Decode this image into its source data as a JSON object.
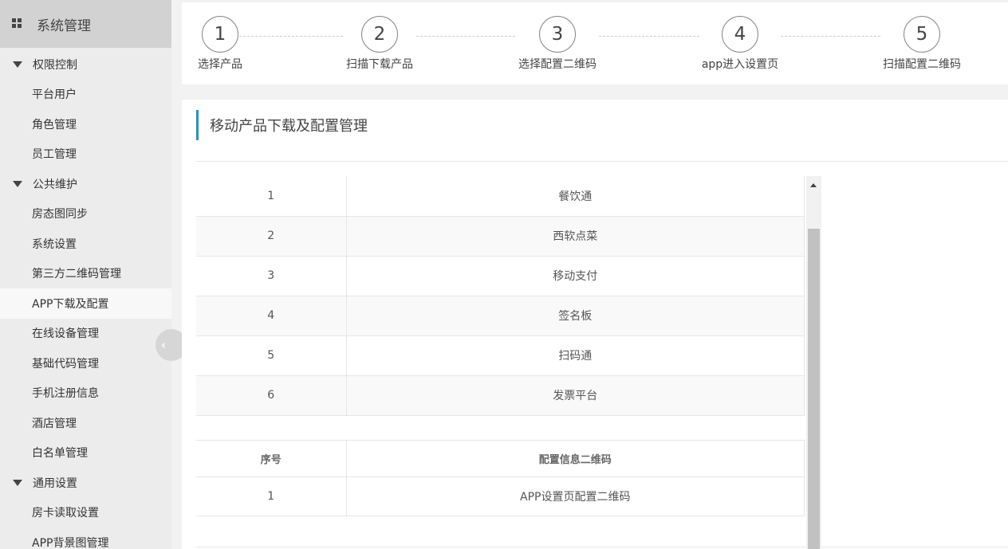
{
  "sidebar": {
    "title": "系统管理",
    "groups": [
      {
        "label": "权限控制",
        "items": [
          "平台用户",
          "角色管理",
          "员工管理"
        ]
      },
      {
        "label": "公共维护",
        "items": [
          "房态图同步",
          "系统设置",
          "第三方二维码管理",
          "APP下载及配置",
          "在线设备管理",
          "基础代码管理",
          "手机注册信息",
          "酒店管理",
          "白名单管理"
        ]
      },
      {
        "label": "通用设置",
        "items": [
          "房卡读取设置",
          "APP背景图管理"
        ]
      }
    ]
  },
  "steps": [
    {
      "num": "1",
      "label": "选择产品"
    },
    {
      "num": "2",
      "label": "扫描下载产品"
    },
    {
      "num": "3",
      "label": "选择配置二维码"
    },
    {
      "num": "4",
      "label": "app进入设置页"
    },
    {
      "num": "5",
      "label": "扫描配置二维码"
    }
  ],
  "section_title": "移动产品下载及配置管理",
  "products": [
    {
      "idx": "1",
      "name": "餐饮通"
    },
    {
      "idx": "2",
      "name": "西软点菜"
    },
    {
      "idx": "3",
      "name": "移动支付"
    },
    {
      "idx": "4",
      "name": "签名板"
    },
    {
      "idx": "5",
      "name": "扫码通"
    },
    {
      "idx": "6",
      "name": "发票平台"
    }
  ],
  "config_table": {
    "headers": [
      "序号",
      "配置信息二维码"
    ],
    "rows": [
      {
        "idx": "1",
        "name": "APP设置页配置二维码"
      }
    ]
  }
}
